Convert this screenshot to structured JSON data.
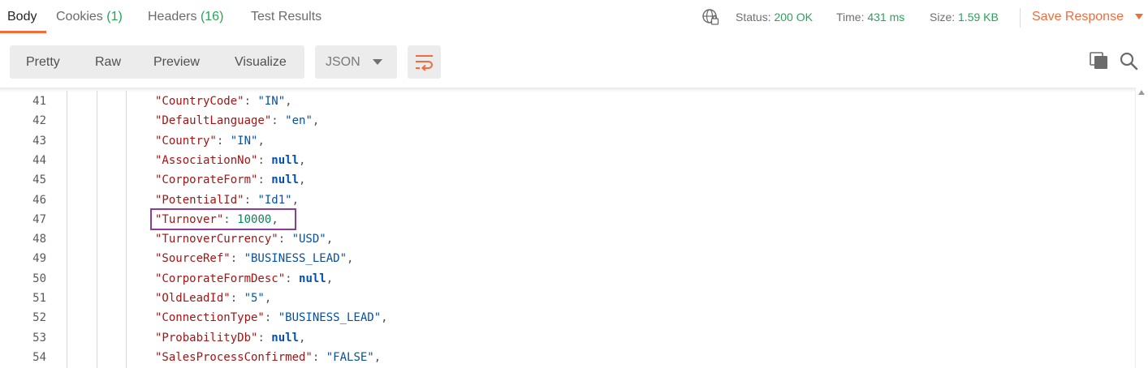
{
  "tabs": [
    {
      "label": "Body",
      "count": ""
    },
    {
      "label": "Cookies",
      "count": "(1)"
    },
    {
      "label": "Headers",
      "count": "(16)"
    },
    {
      "label": "Test Results",
      "count": ""
    }
  ],
  "status": {
    "status_label": "Status:",
    "status_value": "200 OK",
    "time_label": "Time:",
    "time_value": "431 ms",
    "size_label": "Size:",
    "size_value": "1.59 KB"
  },
  "save_response": "Save Response",
  "view_modes": [
    "Pretty",
    "Raw",
    "Preview",
    "Visualize"
  ],
  "format": "JSON",
  "icons": {
    "globe": "globe-lock-icon",
    "wrap": "wrap-lines-icon",
    "copy": "copy-icon",
    "search": "search-icon"
  },
  "colors": {
    "accent": "#f26b3a",
    "success": "#26a557",
    "json_key": "#a31515",
    "json_string": "#0451a5",
    "json_number": "#098658",
    "highlight_box": "#8e3c96"
  },
  "code_lines": [
    {
      "no": "41",
      "key": "\"CountryCode\"",
      "value": "\"IN\"",
      "vtype": "s"
    },
    {
      "no": "42",
      "key": "\"DefaultLanguage\"",
      "value": "\"en\"",
      "vtype": "s"
    },
    {
      "no": "43",
      "key": "\"Country\"",
      "value": "\"IN\"",
      "vtype": "s"
    },
    {
      "no": "44",
      "key": "\"AssociationNo\"",
      "value": "null",
      "vtype": "nl"
    },
    {
      "no": "45",
      "key": "\"CorporateForm\"",
      "value": "null",
      "vtype": "nl"
    },
    {
      "no": "46",
      "key": "\"PotentialId\"",
      "value": "\"Id1\"",
      "vtype": "s"
    },
    {
      "no": "47",
      "key": "\"Turnover\"",
      "value": "10000",
      "vtype": "n"
    },
    {
      "no": "48",
      "key": "\"TurnoverCurrency\"",
      "value": "\"USD\"",
      "vtype": "s"
    },
    {
      "no": "49",
      "key": "\"SourceRef\"",
      "value": "\"BUSINESS_LEAD\"",
      "vtype": "s"
    },
    {
      "no": "50",
      "key": "\"CorporateFormDesc\"",
      "value": "null",
      "vtype": "nl"
    },
    {
      "no": "51",
      "key": "\"OldLeadId\"",
      "value": "\"5\"",
      "vtype": "s"
    },
    {
      "no": "52",
      "key": "\"ConnectionType\"",
      "value": "\"BUSINESS_LEAD\"",
      "vtype": "s"
    },
    {
      "no": "53",
      "key": "\"ProbabilityDb\"",
      "value": "null",
      "vtype": "nl"
    },
    {
      "no": "54",
      "key": "\"SalesProcessConfirmed\"",
      "value": "\"FALSE\"",
      "vtype": "s"
    }
  ]
}
